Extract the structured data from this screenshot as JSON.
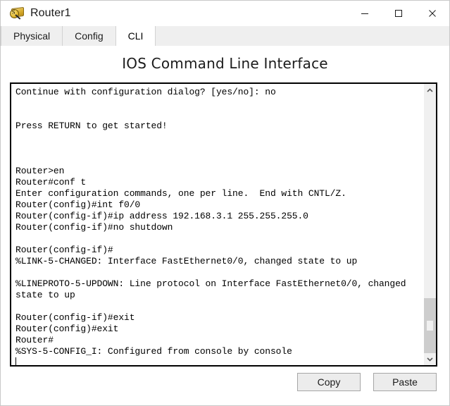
{
  "window": {
    "title": "Router1",
    "icon": "router-icon",
    "controls": {
      "minimize": "minimize-icon",
      "maximize": "maximize-icon",
      "close": "close-icon"
    }
  },
  "tabs": [
    {
      "label": "Physical",
      "active": false
    },
    {
      "label": "Config",
      "active": false
    },
    {
      "label": "CLI",
      "active": true
    }
  ],
  "main": {
    "heading": "IOS Command Line Interface",
    "terminal_lines": [
      "Continue with configuration dialog? [yes/no]: no",
      "",
      "",
      "Press RETURN to get started!",
      "",
      "",
      "",
      "Router>en",
      "Router#conf t",
      "Enter configuration commands, one per line.  End with CNTL/Z.",
      "Router(config)#int f0/0",
      "Router(config-if)#ip address 192.168.3.1 255.255.255.0",
      "Router(config-if)#no shutdown",
      "",
      "Router(config-if)#",
      "%LINK-5-CHANGED: Interface FastEthernet0/0, changed state to up",
      "",
      "%LINEPROTO-5-UPDOWN: Line protocol on Interface FastEthernet0/0, changed",
      "state to up",
      "",
      "Router(config-if)#exit",
      "Router(config)#exit",
      "Router#",
      "%SYS-5-CONFIG_I: Configured from console by console"
    ],
    "scrollbar": {
      "up_arrow": "chevron-up-icon",
      "down_arrow": "chevron-down-icon"
    },
    "buttons": {
      "copy": "Copy",
      "paste": "Paste"
    }
  },
  "colors": {
    "window_bg": "#ffffff",
    "tabstrip_bg": "#efefef",
    "terminal_border": "#000000",
    "button_bg": "#ececec",
    "scrollbar_thumb": "#cdcdcd"
  }
}
